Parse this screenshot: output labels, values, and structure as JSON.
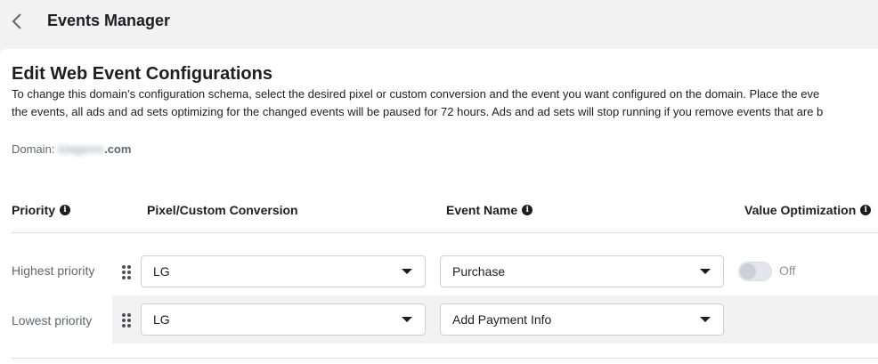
{
  "header": {
    "title": "Events Manager"
  },
  "page": {
    "title": "Edit Web Event Configurations",
    "description_line1": "To change this domain's configuration schema, select the desired pixel or custom conversion and the event you want configured on the domain. Place the eve",
    "description_line2": "the events, all ads and ad sets optimizing for the changed events will be paused for 72 hours. Ads and ad sets will stop running if you remove events that are b",
    "domain_label": "Domain:",
    "domain_masked": "lolagems",
    "domain_suffix": ".com"
  },
  "table": {
    "columns": {
      "priority": "Priority",
      "pixel": "Pixel/Custom Conversion",
      "event": "Event Name",
      "value": "Value Optimization"
    },
    "rows": [
      {
        "priority_label": "Highest priority",
        "pixel": "LG",
        "event": "Purchase",
        "value_toggle": "Off"
      },
      {
        "priority_label": "Lowest priority",
        "pixel": "LG",
        "event": "Add Payment Info"
      }
    ]
  },
  "icons": {
    "back": "chevron-left-icon",
    "info": "info-icon",
    "drag": "drag-handle-icon",
    "caret": "caret-down-icon"
  }
}
